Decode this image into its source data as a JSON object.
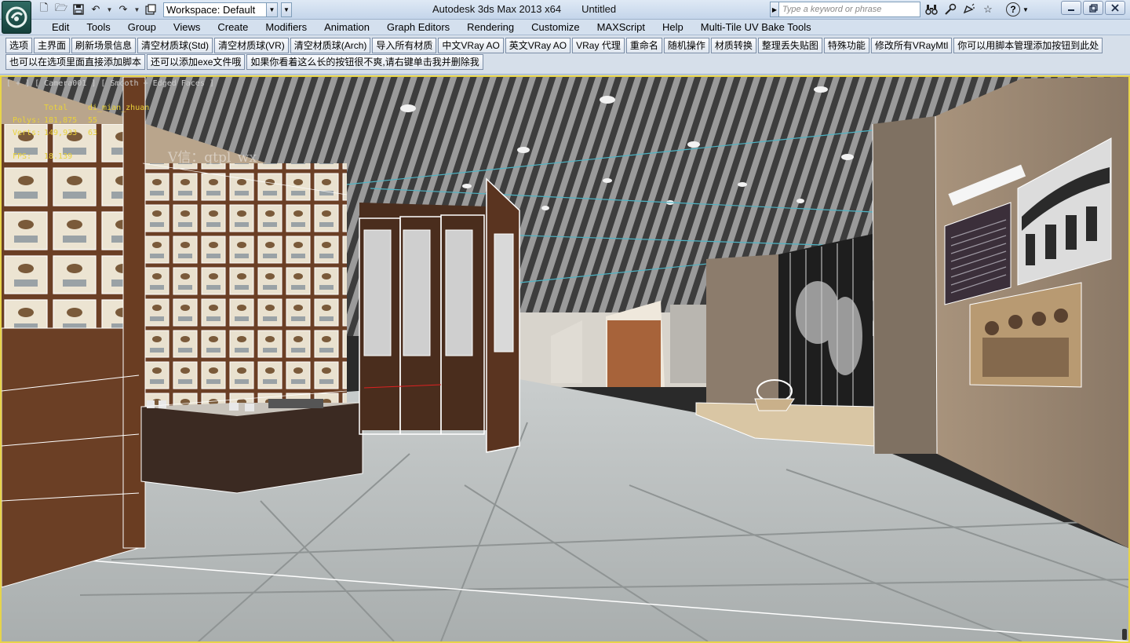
{
  "titlebar": {
    "workspace_value": "Workspace: Default",
    "app_name": "Autodesk 3ds Max  2013 x64",
    "document": "Untitled",
    "search_placeholder": "Type a keyword or phrase"
  },
  "menu": [
    {
      "label": "Edit"
    },
    {
      "label": "Tools"
    },
    {
      "label": "Group"
    },
    {
      "label": "Views"
    },
    {
      "label": "Create"
    },
    {
      "label": "Modifiers"
    },
    {
      "label": "Animation"
    },
    {
      "label": "Graph Editors"
    },
    {
      "label": "Rendering"
    },
    {
      "label": "Customize"
    },
    {
      "label": "MAXScript"
    },
    {
      "label": "Help"
    },
    {
      "label": "Multi-Tile UV Bake Tools"
    }
  ],
  "script_toolbar": {
    "row1": [
      {
        "label": "选项"
      },
      {
        "label": "主界面"
      },
      {
        "label": "刷新场景信息"
      },
      {
        "label": "清空材质球(Std)"
      },
      {
        "label": "清空材质球(VR)"
      },
      {
        "label": "清空材质球(Arch)"
      },
      {
        "label": "导入所有材质"
      },
      {
        "label": "中文VRay AO"
      },
      {
        "label": "英文VRay AO"
      },
      {
        "label": "VRay 代理"
      },
      {
        "label": "重命名"
      },
      {
        "label": "随机操作"
      },
      {
        "label": "材质转换"
      },
      {
        "label": "整理丢失贴图"
      },
      {
        "label": "特殊功能"
      },
      {
        "label": "修改所有VRayMtl"
      },
      {
        "label": "你可以用脚本管理添加按钮到此处"
      }
    ],
    "row2": [
      {
        "label": "也可以在选项里面直接添加脚本"
      },
      {
        "label": "还可以添加exe文件哦"
      },
      {
        "label": "如果你看着这么长的按钮很不爽,请右键单击我并删除我"
      }
    ]
  },
  "viewport": {
    "label": "[ + ] [ Camera001 ] [ Smooth + Edged Faces ]",
    "stats": {
      "header": [
        "",
        "Total",
        "di_mian_zhuan"
      ],
      "polys": [
        "Polys:",
        "181,875",
        "55"
      ],
      "verts": [
        "Verts:",
        "149,933",
        "63"
      ],
      "fps": [
        "FPS:",
        "18.139"
      ]
    },
    "watermark": "V信：qtpl_wx"
  },
  "colors": {
    "viewport_border": "#e7d44a",
    "stats_text": "#e9d23a",
    "titlebar_top": "#dfe9f5",
    "menubar": "#d4e0ee"
  }
}
